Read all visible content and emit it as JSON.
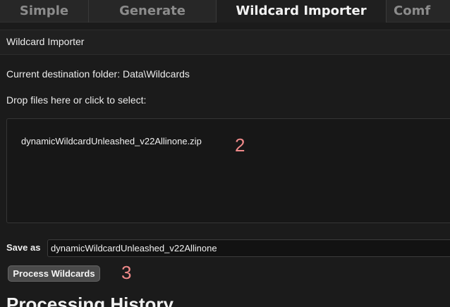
{
  "tabs": [
    {
      "label": "Simple",
      "active": false
    },
    {
      "label": "Generate",
      "active": false
    },
    {
      "label": "Wildcard Importer",
      "active": true
    },
    {
      "label": "Comf",
      "active": false
    }
  ],
  "section": {
    "title": "Wildcard Importer"
  },
  "destination_text": "Current destination folder: Data\\Wildcards",
  "dropzone": {
    "label": "Drop files here or click to select:",
    "file_name": "dynamicWildcardUnleashed_v22Allinone.zip"
  },
  "annotations": {
    "dropzone_marker": "2",
    "button_marker": "3"
  },
  "save": {
    "label": "Save as",
    "value": "dynamicWildcardUnleashed_v22Allinone"
  },
  "process_button_label": "Process Wildcards",
  "history_heading": "Processing History",
  "colors": {
    "background": "#1b1b1b",
    "tab_bar": "#272727",
    "annotation": "#f08a8a",
    "button": "#4a4a4a"
  }
}
